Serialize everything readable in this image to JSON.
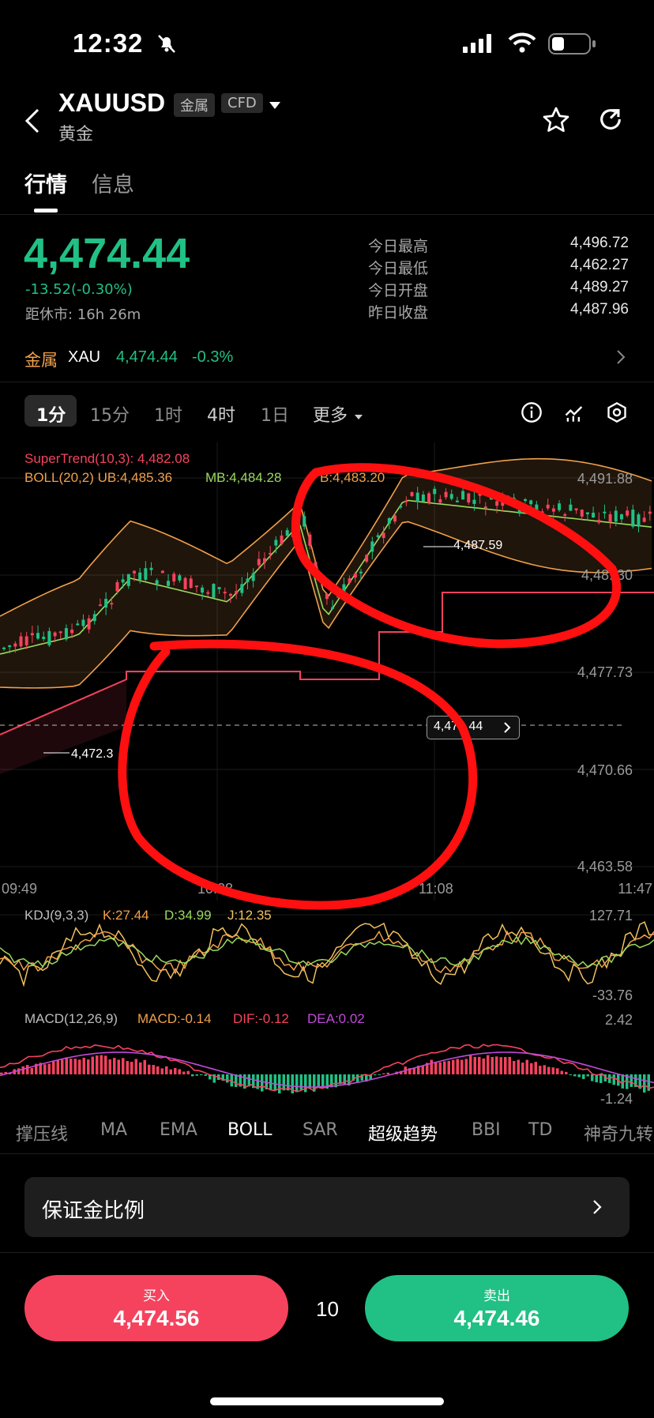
{
  "status_bar": {
    "time": "12:32"
  },
  "header": {
    "symbol": "XAUUSD",
    "tag_category": "金属",
    "tag_type": "CFD",
    "subtitle": "黄金"
  },
  "main_tabs": [
    "行情",
    "信息"
  ],
  "quote": {
    "price": "4,474.44",
    "change": "-13.52(-0.30%)",
    "close_countdown": "距休市: 16h 26m",
    "stats": [
      {
        "label": "今日最高",
        "value": "4,496.72"
      },
      {
        "label": "今日最低",
        "value": "4,462.27"
      },
      {
        "label": "今日开盘",
        "value": "4,489.27"
      },
      {
        "label": "昨日收盘",
        "value": "4,487.96"
      }
    ]
  },
  "related": {
    "category": "金属",
    "symbol": "XAU",
    "price": "4,474.44",
    "change": "-0.3%"
  },
  "intervals": [
    "1分",
    "15分",
    "1时",
    "4时",
    "1日",
    "更多"
  ],
  "chart": {
    "supertrend_legend": "SuperTrend(10,3): 4,482.08",
    "boll_legend": "BOLL(20,2) UB:4,485.36",
    "boll_mb": "MB:4,484.28",
    "boll_lb": "B:4,483.20",
    "y_labels": [
      "4,491.88",
      "4,48..30",
      "4,477.73",
      "4,470.66",
      "4,463.58"
    ],
    "x_labels": [
      "09:49",
      "10:28",
      "11:08",
      "11:47"
    ],
    "high_marker": "4,487.59",
    "low_marker": "4,472.3",
    "current_price_tag": "4,474.44"
  },
  "kdj": {
    "label": "KDJ(9,3,3)",
    "k": "K:27.44",
    "d": "D:34.99",
    "j": "J:12.35",
    "max": "127.71",
    "min": "-33.76"
  },
  "macd": {
    "label": "MACD(12,26,9)",
    "macd": "MACD:-0.14",
    "dif": "DIF:-0.12",
    "dea": "DEA:0.02",
    "max": "2.42",
    "min": "-1.24"
  },
  "indicator_tabs": [
    "撑压线",
    "MA",
    "EMA",
    "BOLL",
    "SAR",
    "超级趋势",
    "BBI",
    "TD",
    "神奇九转"
  ],
  "margin_row": {
    "label": "保证金比例"
  },
  "trade": {
    "buy_label": "买入",
    "buy_price": "4,474.56",
    "quantity": "10",
    "sell_label": "卖出",
    "sell_price": "4,474.46"
  },
  "colors": {
    "green": "#21c085",
    "red": "#f5435e",
    "orange": "#f0a04b",
    "purple": "#c04ad8"
  }
}
